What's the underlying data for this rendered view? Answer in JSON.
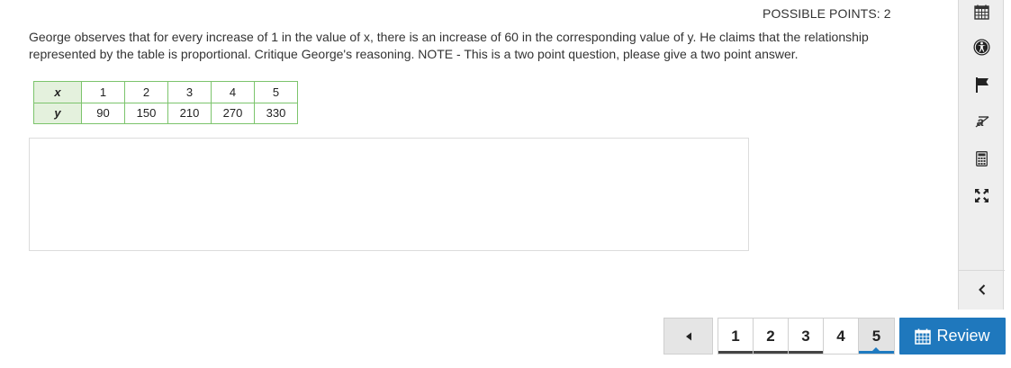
{
  "header": {
    "possible_points": "POSSIBLE POINTS: 2"
  },
  "question": {
    "text": "George observes that for every increase of 1 in the value of x, there is an increase of 60 in the corresponding value of y. He claims that the relationship represented by the table is proportional. Critique George's reasoning.  NOTE - This is a two point question, please give a two point answer."
  },
  "table": {
    "x_label": "x",
    "y_label": "y",
    "x_values": [
      "1",
      "2",
      "3",
      "4",
      "5"
    ],
    "y_values": [
      "90",
      "150",
      "210",
      "270",
      "330"
    ]
  },
  "answer": {
    "value": ""
  },
  "toolbar": {
    "tools": [
      "calendar-icon",
      "accessibility-icon",
      "flag-icon",
      "strikethrough-icon",
      "calculator-icon",
      "fullscreen-icon"
    ],
    "collapse": "chevron-left-icon"
  },
  "pagination": {
    "prev": "◂",
    "pages": [
      "1",
      "2",
      "3",
      "4",
      "5"
    ],
    "current": "5",
    "review_label": "Review"
  },
  "colors": {
    "accent": "#1f78bd",
    "table_border": "#7cc46c",
    "table_header": "#e4f1dd"
  }
}
